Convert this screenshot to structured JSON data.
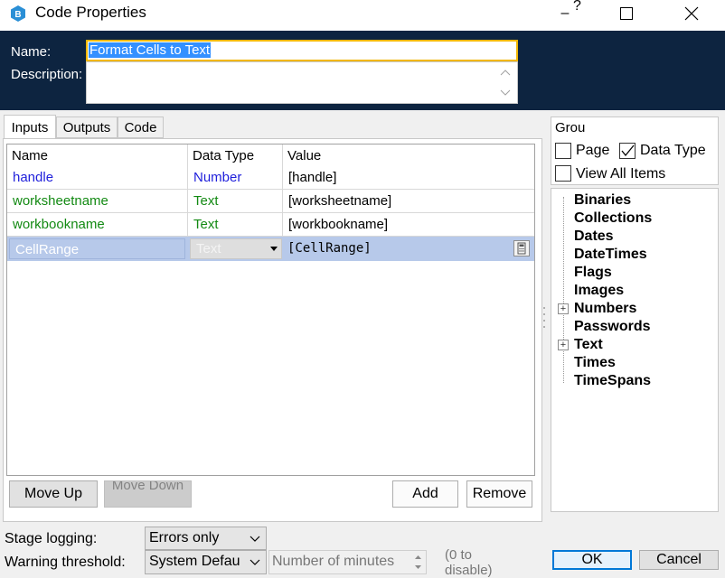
{
  "window": {
    "title": "Code Properties",
    "minimize_glyph": "–",
    "help_glyph": "?",
    "maximize_glyph": "☐",
    "close_glyph": "✕"
  },
  "header": {
    "name_label": "Name:",
    "name_value": "Format Cells to Text",
    "description_label": "Description:"
  },
  "tabs": [
    {
      "label": "Inputs",
      "active": true
    },
    {
      "label": "Outputs",
      "active": false
    },
    {
      "label": "Code",
      "active": false
    }
  ],
  "grid": {
    "columns": [
      "Name",
      "Data Type",
      "Value"
    ],
    "rows": [
      {
        "name": "handle",
        "type": "Number",
        "value": "[handle]",
        "color": "#1f1fdb"
      },
      {
        "name": "worksheetname",
        "type": "Text",
        "value": "[worksheetname]",
        "color": "#138a13"
      },
      {
        "name": "workbookname",
        "type": "Text",
        "value": "[workbookname]",
        "color": "#138a13"
      },
      {
        "name": "CellRange",
        "type": "Text",
        "value": "[CellRange]",
        "color": "#ffffff"
      }
    ]
  },
  "buttons": {
    "move_up": "Move Up",
    "move_down": "Move Down",
    "add": "Add",
    "remove": "Remove",
    "ok": "OK",
    "cancel": "Cancel"
  },
  "group_panel": {
    "title": "Grou",
    "page_label": "Page",
    "page_checked": false,
    "datatype_label": "Data Type",
    "datatype_checked": true,
    "viewall_label": "View All Items",
    "viewall_checked": false
  },
  "tree": [
    {
      "label": "Binaries",
      "expandable": false
    },
    {
      "label": "Collections",
      "expandable": false
    },
    {
      "label": "Dates",
      "expandable": false
    },
    {
      "label": "DateTimes",
      "expandable": false
    },
    {
      "label": "Flags",
      "expandable": false
    },
    {
      "label": "Images",
      "expandable": false
    },
    {
      "label": "Numbers",
      "expandable": true
    },
    {
      "label": "Passwords",
      "expandable": false
    },
    {
      "label": "Text",
      "expandable": true
    },
    {
      "label": "Times",
      "expandable": false
    },
    {
      "label": "TimeSpans",
      "expandable": false
    }
  ],
  "footer": {
    "stage_logging_label": "Stage logging:",
    "stage_logging_value": "Errors only",
    "warning_label": "Warning threshold:",
    "warning_value": "System Defau",
    "minutes_placeholder": "Number of minutes",
    "disable_note": "(0 to disable)"
  },
  "colors": {
    "header_bg": "#0d2440",
    "selection": "#3390ff",
    "name_border": "#f2b705",
    "selected_row": "#b7c9ea"
  }
}
